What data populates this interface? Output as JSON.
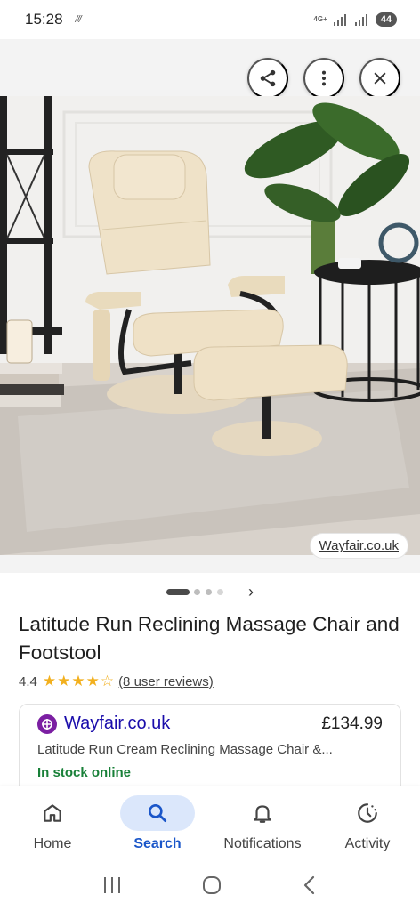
{
  "status_bar": {
    "time": "15:28",
    "network_label": "4G+",
    "battery": "44"
  },
  "viewer": {
    "source_label": "Wayfair.co.uk",
    "buttons": [
      "share-icon",
      "more-vert-icon",
      "close-icon"
    ],
    "pager": {
      "total": 4,
      "active": 1
    }
  },
  "product": {
    "title": "Latitude Run Reclining Massage Chair and Footstool",
    "rating": "4.4",
    "stars_display": "★★★★☆",
    "reviews": "(8 user reviews)"
  },
  "offer": {
    "merchant": "Wayfair.co.uk",
    "price": "£134.99",
    "description": "Latitude Run Cream Reclining Massage Chair &...",
    "stock": "In stock online"
  },
  "bottom_nav": {
    "items": [
      {
        "label": "Home",
        "icon": "home-icon"
      },
      {
        "label": "Search",
        "icon": "search-icon",
        "active": true
      },
      {
        "label": "Notifications",
        "icon": "bell-icon"
      },
      {
        "label": "Activity",
        "icon": "history-icon"
      }
    ]
  },
  "colors": {
    "accent": "#1a56c9",
    "active_pill": "#dbe7fb",
    "in_stock": "#188038",
    "link": "#1a0dab",
    "star": "#f2b01e",
    "merchant_logo": "#7b1fa2"
  }
}
